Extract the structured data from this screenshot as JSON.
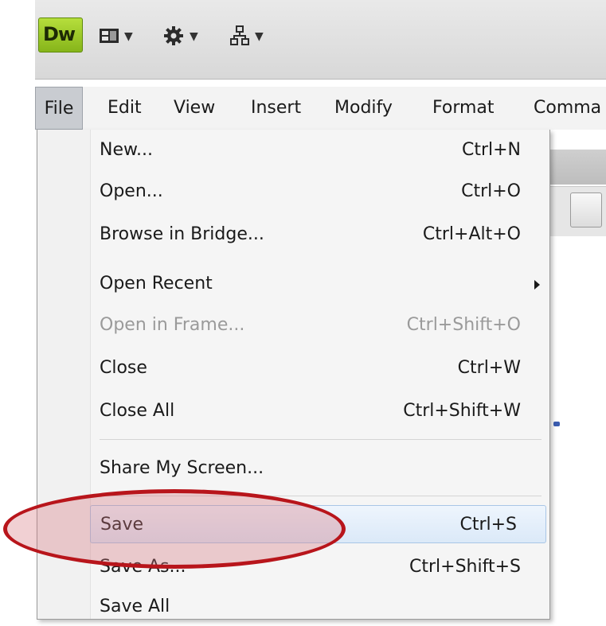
{
  "app": {
    "logo_text": "Dw",
    "toolbar_buttons": [
      {
        "icon": "layout-icon"
      },
      {
        "icon": "gear-icon"
      },
      {
        "icon": "site-map-icon"
      }
    ]
  },
  "menubar": {
    "items": [
      "File",
      "Edit",
      "View",
      "Insert",
      "Modify",
      "Format",
      "Comma"
    ]
  },
  "file_menu": {
    "items": [
      {
        "label": "New...",
        "shortcut": "Ctrl+N"
      },
      {
        "label": "Open...",
        "shortcut": "Ctrl+O"
      },
      {
        "label": "Browse in Bridge...",
        "shortcut": "Ctrl+Alt+O"
      },
      {
        "label": "Open Recent",
        "shortcut": "",
        "submenu": true
      },
      {
        "label": "Open in Frame...",
        "shortcut": "Ctrl+Shift+O",
        "disabled": true
      },
      {
        "label": "Close",
        "shortcut": "Ctrl+W"
      },
      {
        "label": "Close All",
        "shortcut": "Ctrl+Shift+W"
      },
      {
        "label": "Share My Screen...",
        "shortcut": ""
      },
      {
        "label": "Save",
        "shortcut": "Ctrl+S",
        "highlighted": true
      },
      {
        "label": "Save As...",
        "shortcut": "Ctrl+Shift+S"
      },
      {
        "label": "Save All",
        "shortcut": ""
      }
    ]
  },
  "colors": {
    "annotation": "#b8151b",
    "highlight": "#dbe9f8",
    "logo": "#9acb2a"
  }
}
